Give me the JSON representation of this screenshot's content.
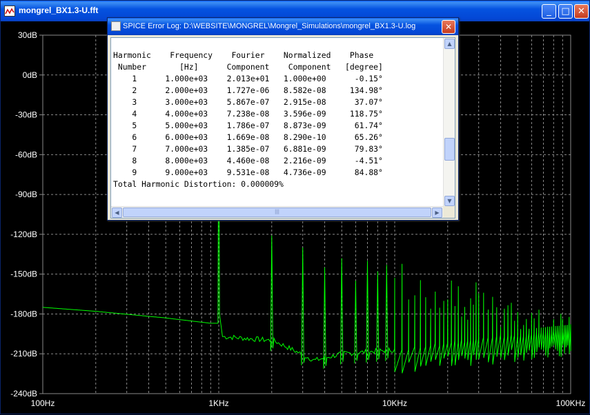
{
  "window": {
    "title": "mongrel_BX1.3-U.fft",
    "minimize_glyph": "_",
    "maximize_glyph": "□",
    "close_glyph": "✕"
  },
  "dialog": {
    "title": "SPICE Error Log: D:\\WEBSITE\\MONGREL\\Mongrel_Simulations\\mongrel_BX1.3-U.log",
    "close_glyph": "✕",
    "log_text": "Harmonic    Frequency    Fourier    Normalized    Phase\n Number       [Hz]      Component    Component   [degree]\n    1      1.000e+03    2.013e+01   1.000e+00      -0.15°\n    2      2.000e+03    1.727e-06   8.582e-08     134.98°\n    3      3.000e+03    5.867e-07   2.915e-08      37.07°\n    4      4.000e+03    7.238e-08   3.596e-09     118.75°\n    5      5.000e+03    1.786e-07   8.873e-09      61.74°\n    6      6.000e+03    1.669e-08   8.290e-10      65.26°\n    7      7.000e+03    1.385e-07   6.881e-09      79.83°\n    8      8.000e+03    4.460e-08   2.216e-09      -4.51°\n    9      9.000e+03    9.531e-08   4.736e-09      84.88°\nTotal Harmonic Distortion: 0.000009%",
    "scroll_up_glyph": "▲",
    "scroll_down_glyph": "▼",
    "scroll_left_glyph": "◀",
    "scroll_right_glyph": "▶",
    "thumb_grip": "|||"
  },
  "chart_data": {
    "type": "line",
    "x_scale": "log",
    "xlim": [
      100,
      100000
    ],
    "ylim": [
      -240,
      30
    ],
    "grid": true,
    "x_ticks": [
      {
        "value": 100,
        "label": "100Hz"
      },
      {
        "value": 1000,
        "label": "1KHz"
      },
      {
        "value": 10000,
        "label": "10KHz"
      },
      {
        "value": 100000,
        "label": "100KHz"
      }
    ],
    "y_ticks": [
      {
        "value": 30,
        "label": "30dB"
      },
      {
        "value": 0,
        "label": "0dB"
      },
      {
        "value": -30,
        "label": "-30dB"
      },
      {
        "value": -60,
        "label": "-60dB"
      },
      {
        "value": -90,
        "label": "-90dB"
      },
      {
        "value": -120,
        "label": "-120dB"
      },
      {
        "value": -150,
        "label": "-150dB"
      },
      {
        "value": -180,
        "label": "-180dB"
      },
      {
        "value": -210,
        "label": "-210dB"
      },
      {
        "value": -240,
        "label": "-240dB"
      }
    ],
    "colors": {
      "trace": "#00ff00",
      "grid": "#8a8a8a",
      "axis": "#8a8a8a",
      "label": "#ffffff",
      "background": "#000000"
    },
    "series": [
      {
        "floor": [
          [
            100,
            -175
          ],
          [
            200,
            -178
          ],
          [
            500,
            -183
          ],
          [
            900,
            -187
          ],
          [
            1000,
            -187
          ]
        ],
        "harmonic_peaks": [
          [
            1000,
            20.1
          ],
          [
            2000,
            -121
          ],
          [
            3000,
            -130
          ],
          [
            4000,
            -145
          ],
          [
            5000,
            -138
          ],
          [
            6000,
            -155
          ],
          [
            7000,
            -140
          ],
          [
            8000,
            -148
          ],
          [
            9000,
            -143
          ]
        ],
        "noise_floor": [
          [
            1050,
            -197
          ],
          [
            2050,
            -200
          ],
          [
            3500,
            -215
          ],
          [
            5000,
            -210
          ],
          [
            10000,
            -207
          ],
          [
            20000,
            -202
          ],
          [
            50000,
            -196
          ],
          [
            100000,
            -192
          ]
        ],
        "spur_decline_end": [
          [
            10000,
            -150
          ],
          [
            100000,
            -185
          ]
        ]
      }
    ]
  }
}
